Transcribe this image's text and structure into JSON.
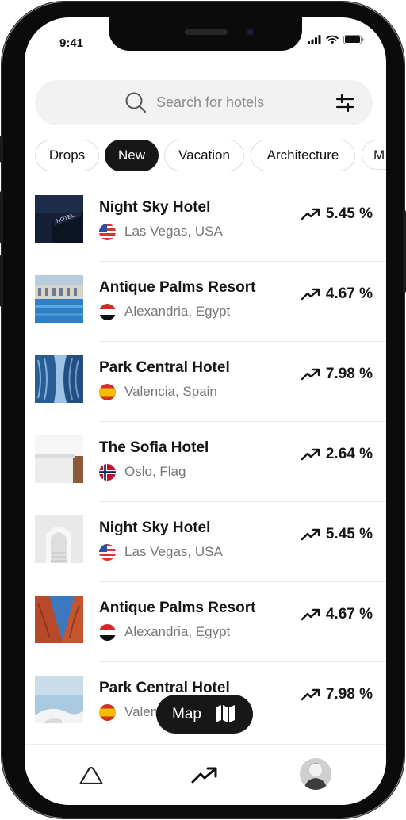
{
  "status_bar": {
    "time": "9:41"
  },
  "search": {
    "placeholder": "Search for hotels"
  },
  "chips": [
    {
      "label": "Drops",
      "active": false
    },
    {
      "label": "New",
      "active": true
    },
    {
      "label": "Vacation",
      "active": false
    },
    {
      "label": "Architecture",
      "active": false
    },
    {
      "label": "M",
      "active": false
    }
  ],
  "hotels": [
    {
      "name": "Night Sky Hotel",
      "location": "Las Vegas, USA",
      "flag": "us-flag-icon",
      "change": "5.45 %",
      "image": "night-hotel-sign-image"
    },
    {
      "name": "Antique Palms Resort",
      "location": "Alexandria, Egypt",
      "flag": "egypt-flag-icon",
      "change": "4.67 %",
      "image": "resort-pool-image"
    },
    {
      "name": "Park Central Hotel",
      "location": "Valencia, Spain",
      "flag": "spain-flag-icon",
      "change": "7.98 %",
      "image": "blue-curved-building-image"
    },
    {
      "name": "The Sofia Hotel",
      "location": "Oslo, Flag",
      "flag": "norway-flag-icon",
      "change": "2.64 %",
      "image": "white-wall-interior-image"
    },
    {
      "name": "Night Sky Hotel",
      "location": "Las Vegas, USA",
      "flag": "us-flag-icon",
      "change": "5.45 %",
      "image": "white-arches-image"
    },
    {
      "name": "Antique Palms Resort",
      "location": "Alexandria, Egypt",
      "flag": "egypt-flag-icon",
      "change": "4.67 %",
      "image": "red-terracotta-building-image"
    },
    {
      "name": "Park Central Hotel",
      "location": "Valencia, Spain",
      "flag": "spain-flag-icon",
      "change": "7.98 %",
      "image": "sky-rooftop-image"
    }
  ],
  "map_button": {
    "label": "Map"
  },
  "colors": {
    "accent": "#171717",
    "muted_text": "#777777",
    "chip_border": "#dedede",
    "search_bg": "#f2f2f2"
  }
}
